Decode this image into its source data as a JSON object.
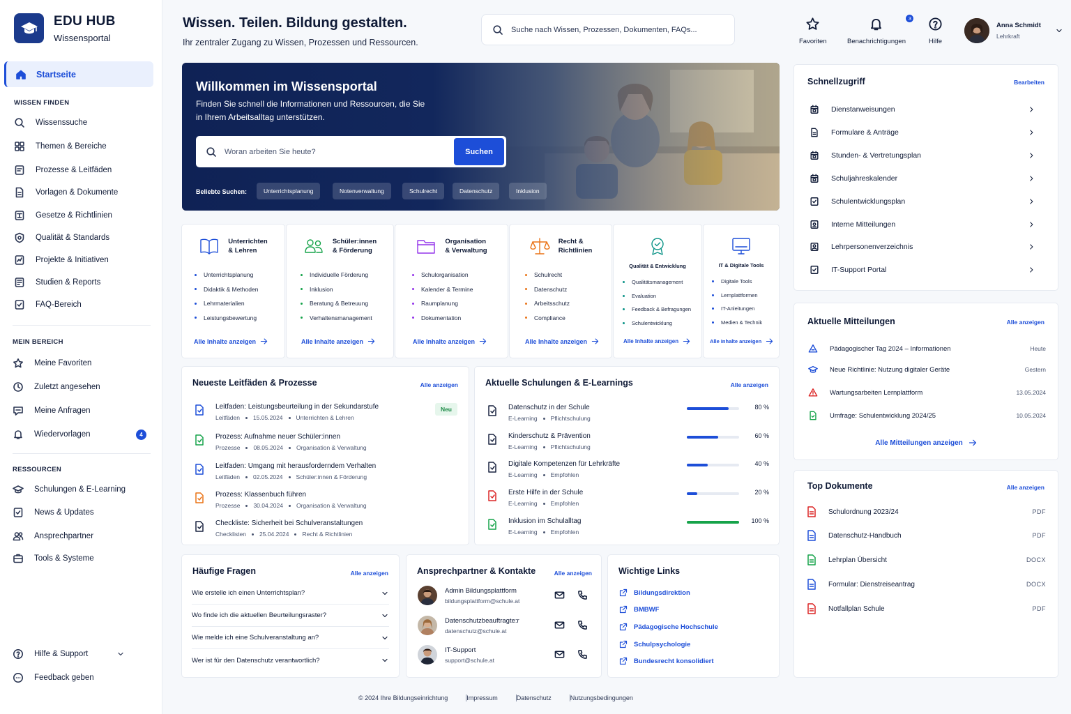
{
  "brand": {
    "title": "EDU HUB",
    "subtitle": "Wissensportal",
    "accent": "#1d4ed8",
    "dark": "#1b3a8c"
  },
  "sidebar": {
    "active": {
      "label": "Startseite",
      "icon": "home-icon"
    },
    "sections": [
      {
        "title": "WISSEN FINDEN",
        "items": [
          {
            "label": "Wissenssuche",
            "icon": "search-icon"
          },
          {
            "label": "Themen & Bereiche",
            "icon": "grid-icon"
          },
          {
            "label": "Prozesse & Leitfäden",
            "icon": "process-icon"
          },
          {
            "label": "Vorlagen & Dokumente",
            "icon": "document-icon"
          },
          {
            "label": "Gesetze & Richtlinien",
            "icon": "scale-icon"
          },
          {
            "label": "Qualität & Standards",
            "icon": "badge-icon"
          },
          {
            "label": "Projekte & Initiativen",
            "icon": "project-icon"
          },
          {
            "label": "Studien & Reports",
            "icon": "report-icon"
          },
          {
            "label": "FAQ-Bereich",
            "icon": "faq-icon"
          }
        ]
      },
      {
        "title": "MEIN BEREICH",
        "items": [
          {
            "label": "Meine Favoriten",
            "icon": "star-icon"
          },
          {
            "label": "Zuletzt angesehen",
            "icon": "clock-icon"
          },
          {
            "label": "Meine Anfragen",
            "icon": "chat-icon"
          },
          {
            "label": "Wiedervorlagen",
            "icon": "bell-icon",
            "badge": "4"
          }
        ]
      },
      {
        "title": "RESSOURCEN",
        "items": [
          {
            "label": "Schulungen & E-Learning",
            "icon": "graduation-icon"
          },
          {
            "label": "News & Updates",
            "icon": "news-icon"
          },
          {
            "label": "Ansprechpartner",
            "icon": "people-icon"
          },
          {
            "label": "Tools & Systeme",
            "icon": "tools-icon"
          }
        ]
      }
    ],
    "bottom": [
      {
        "label": "Hilfe & Support",
        "icon": "help-icon"
      },
      {
        "label": "Feedback geben",
        "icon": "feedback-icon"
      }
    ]
  },
  "header": {
    "title": "Wissen. Teilen. Bildung gestalten.",
    "subtitle": "Ihr zentraler Zugang zu Wissen, Prozessen und Ressourcen.",
    "search_placeholder": "Suche nach Wissen, Prozessen, Dokumenten, FAQs...",
    "actions": [
      {
        "label": "Favoriten",
        "icon": "star-icon"
      },
      {
        "label": "Benachrichtigungen",
        "icon": "bell-icon",
        "badge": "3"
      },
      {
        "label": "Hilfe",
        "icon": "help-icon"
      }
    ],
    "user": {
      "name": "Anna Schmidt",
      "role": "Lehrkraft"
    }
  },
  "hero": {
    "title": "Willkommen im Wissensportal",
    "text": "Finden Sie schnell die Informationen und Ressourcen, die Sie in Ihrem Arbeitsalltag unterstützen.",
    "search_placeholder": "Woran arbeiten Sie heute?",
    "button": "Suchen",
    "popular_label": "Beliebte Suchen:",
    "popular": [
      "Unterrichtsplanung",
      "Notenverwaltung",
      "Schulrecht",
      "Datenschutz",
      "Inklusion"
    ]
  },
  "categories": [
    {
      "title1": "Unterrichten",
      "title2": "& Lehren",
      "icon": "book-icon",
      "color": "#1d4ed8",
      "items": [
        "Unterrichtsplanung",
        "Didaktik & Methoden",
        "Lehrmaterialien",
        "Leistungsbewertung"
      ],
      "link": "Alle Inhalte anzeigen"
    },
    {
      "title1": "Schüler:innen",
      "title2": "& Förderung",
      "icon": "students-icon",
      "color": "#16a34a",
      "items": [
        "Individuelle Förderung",
        "Inklusion",
        "Beratung & Betreuung",
        "Verhaltensmanagement"
      ],
      "link": "Alle Inhalte anzeigen"
    },
    {
      "title1": "Organisation",
      "title2": "& Verwaltung",
      "icon": "folder-icon",
      "color": "#9333ea",
      "items": [
        "Schulorganisation",
        "Kalender & Termine",
        "Raumplanung",
        "Dokumentation"
      ],
      "link": "Alle Inhalte anzeigen"
    },
    {
      "title1": "Recht &",
      "title2": "Richtlinien",
      "icon": "scale-icon",
      "color": "#ea7317",
      "items": [
        "Schulrecht",
        "Datenschutz",
        "Arbeitsschutz",
        "Compliance"
      ],
      "link": "Alle Inhalte anzeigen"
    },
    {
      "title1": "Qualität & Entwicklung",
      "title2": "",
      "icon": "award-icon",
      "color": "#0d9488",
      "items": [
        "Qualitätsmanagement",
        "Evaluation",
        "Feedback & Befragungen",
        "Schulentwicklung"
      ],
      "link": "Alle Inhalte anzeigen"
    },
    {
      "title1": "IT & Digitale Tools",
      "title2": "",
      "icon": "monitor-icon",
      "color": "#1d4ed8",
      "items": [
        "Digitale Tools",
        "Lernplattformen",
        "IT-Anleitungen",
        "Medien & Technik"
      ],
      "link": "Alle Inhalte anzeigen"
    }
  ],
  "guides": {
    "title": "Neueste Leitfäden & Prozesse",
    "link": "Alle anzeigen",
    "new_badge": "Neu",
    "rows": [
      {
        "title": "Leitfaden: Leistungsbeurteilung in der Sekundarstufe",
        "type": "Leitfäden",
        "date": "15.05.2024",
        "area": "Unterrichten & Lehren",
        "color": "#1d4ed8"
      },
      {
        "title": "Prozess: Aufnahme neuer Schüler:innen",
        "type": "Prozesse",
        "date": "08.05.2024",
        "area": "Organisation & Verwaltung",
        "color": "#16a34a"
      },
      {
        "title": "Leitfaden: Umgang mit herausforderndem Verhalten",
        "type": "Leitfäden",
        "date": "02.05.2024",
        "area": "Schüler:innen & Förderung",
        "color": "#1d4ed8"
      },
      {
        "title": "Prozess: Klassenbuch führen",
        "type": "Prozesse",
        "date": "30.04.2024",
        "area": "Organisation & Verwaltung",
        "color": "#ea7317"
      },
      {
        "title": "Checkliste: Sicherheit bei Schulveranstaltungen",
        "type": "Checklisten",
        "date": "25.04.2024",
        "area": "Recht & Richtlinien",
        "color": "#1a2440"
      }
    ]
  },
  "trainings": {
    "title": "Aktuelle Schulungen & E-Learnings",
    "link": "Alle anzeigen",
    "rows": [
      {
        "title": "Datenschutz in der Schule",
        "type": "E-Learning",
        "tag": "Pflichtschulung",
        "progress": 80,
        "pct": "80 %",
        "color": "#1d4ed8",
        "icon_color": "#1a2440"
      },
      {
        "title": "Kinderschutz & Prävention",
        "type": "E-Learning",
        "tag": "Pflichtschulung",
        "progress": 60,
        "pct": "60 %",
        "color": "#1d4ed8",
        "icon_color": "#1a2440"
      },
      {
        "title": "Digitale Kompetenzen für Lehrkräfte",
        "type": "E-Learning",
        "tag": "Empfohlen",
        "progress": 40,
        "pct": "40 %",
        "color": "#1d4ed8",
        "icon_color": "#1a2440"
      },
      {
        "title": "Erste Hilfe in der Schule",
        "type": "E-Learning",
        "tag": "Empfohlen",
        "progress": 20,
        "pct": "20 %",
        "color": "#1d4ed8",
        "icon_color": "#dc2626"
      },
      {
        "title": "Inklusion im Schulalltag",
        "type": "E-Learning",
        "tag": "Empfohlen",
        "progress": 100,
        "pct": "100 %",
        "color": "#16a34a",
        "icon_color": "#16a34a"
      }
    ]
  },
  "faq": {
    "title": "Häufige Fragen",
    "link": "Alle anzeigen",
    "items": [
      "Wie erstelle ich einen Unterrichtsplan?",
      "Wo finde ich die aktuellen Beurteilungsraster?",
      "Wie melde ich eine Schulveranstaltung an?",
      "Wer ist für den Datenschutz verantwortlich?"
    ]
  },
  "contacts": {
    "title": "Ansprechpartner & Kontakte",
    "link": "Alle anzeigen",
    "items": [
      {
        "name": "Admin Bildungsplattform",
        "email": "bildungsplattform@schule.at"
      },
      {
        "name": "Datenschutzbeauftragte:r",
        "email": "datenschutz@schule.at"
      },
      {
        "name": "IT-Support",
        "email": "support@schule.at"
      }
    ]
  },
  "links": {
    "title": "Wichtige Links",
    "items": [
      "Bildungsdirektion",
      "BMBWF",
      "Pädagogische Hochschule",
      "Schulpsychologie",
      "Bundesrecht konsolidiert"
    ]
  },
  "quick": {
    "title": "Schnellzugriff",
    "link": "Bearbeiten",
    "items": [
      {
        "label": "Dienstanweisungen",
        "icon": "calendar-icon"
      },
      {
        "label": "Formulare & Anträge",
        "icon": "form-icon"
      },
      {
        "label": "Stunden- & Vertretungsplan",
        "icon": "calendar-icon"
      },
      {
        "label": "Schuljahreskalender",
        "icon": "calendar-icon"
      },
      {
        "label": "Schulentwicklungsplan",
        "icon": "check-icon"
      },
      {
        "label": "Interne Mitteilungen",
        "icon": "shield-icon"
      },
      {
        "label": "Lehrpersonenverzeichnis",
        "icon": "person-icon"
      },
      {
        "label": "IT-Support Portal",
        "icon": "check-icon"
      }
    ]
  },
  "messages": {
    "title": "Aktuelle Mitteilungen",
    "link": "Alle anzeigen",
    "items": [
      {
        "title": "Pädagogischer Tag 2024 – Informationen",
        "date": "Heute",
        "icon": "triangle-icon",
        "color": "#1d4ed8"
      },
      {
        "title": "Neue Richtlinie: Nutzung digitaler Geräte",
        "date": "Gestern",
        "icon": "graduation-icon",
        "color": "#1d4ed8"
      },
      {
        "title": "Wartungsarbeiten Lernplattform",
        "date": "13.05.2024",
        "icon": "warning-icon",
        "color": "#dc2626"
      },
      {
        "title": "Umfrage: Schulentwicklung 2024/25",
        "date": "10.05.2024",
        "icon": "document-icon",
        "color": "#16a34a"
      }
    ],
    "all": "Alle Mitteilungen anzeigen"
  },
  "top_docs": {
    "title": "Top Dokumente",
    "link": "Alle anzeigen",
    "items": [
      {
        "title": "Schulordnung 2023/24",
        "format": "PDF",
        "color": "#dc2626"
      },
      {
        "title": "Datenschutz-Handbuch",
        "format": "PDF",
        "color": "#1d4ed8"
      },
      {
        "title": "Lehrplan Übersicht",
        "format": "DOCX",
        "color": "#16a34a"
      },
      {
        "title": "Formular: Dienstreiseantrag",
        "format": "DOCX",
        "color": "#1d4ed8"
      },
      {
        "title": "Notfallplan Schule",
        "format": "PDF",
        "color": "#dc2626"
      }
    ]
  },
  "footer": [
    "© 2024 Ihre Bildungseinrichtung",
    "Impressum",
    "Datenschutz",
    "Nutzungsbedingungen"
  ]
}
